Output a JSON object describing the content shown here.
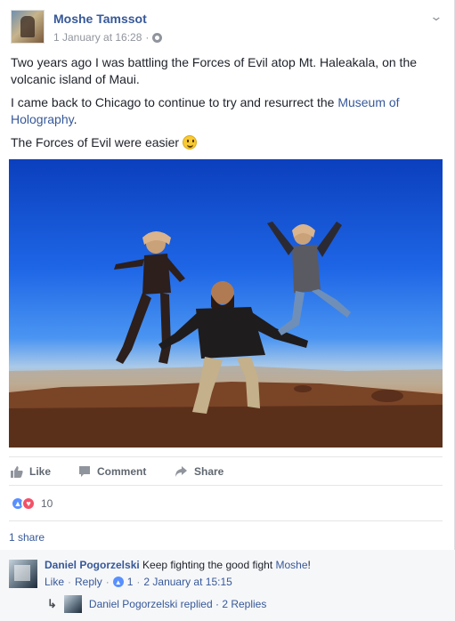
{
  "post": {
    "author": "Moshe Tamssot",
    "timestamp": "1 January at 16:28",
    "meta_separator": "·",
    "privacy_icon": "globe-icon",
    "menu_icon": "chevron-down-icon",
    "paragraphs": {
      "p1": "Two years ago I was battling the Forces of Evil atop Mt. Haleakala, on the volcanic island of Maui.",
      "p2_before": "I came back to Chicago to continue to try and resurrect the ",
      "p2_link": "Museum of Holography",
      "p2_after": ".",
      "p3": "The Forces of Evil were easier "
    },
    "photo_icon": "photo-of-people-jumping-on-mountain"
  },
  "actions": {
    "like": "Like",
    "comment": "Comment",
    "share": "Share"
  },
  "reactions": {
    "count": "10",
    "types": [
      "like",
      "love"
    ]
  },
  "shares": "1 share",
  "comment": {
    "author": "Daniel Pogorzelski",
    "text_before": " Keep fighting the good fight ",
    "mention": "Moshe",
    "text_after": "!",
    "like": "Like",
    "reply": "Reply",
    "like_count": "1",
    "timestamp": "2 January at 15:15",
    "dot": "·"
  },
  "reply_summary": {
    "author": "Daniel Pogorzelski",
    "text": " replied · 2 Replies"
  },
  "colors": {
    "link": "#365899",
    "muted": "#90949c",
    "like_blue": "#5890ff",
    "love_red": "#f25268"
  }
}
